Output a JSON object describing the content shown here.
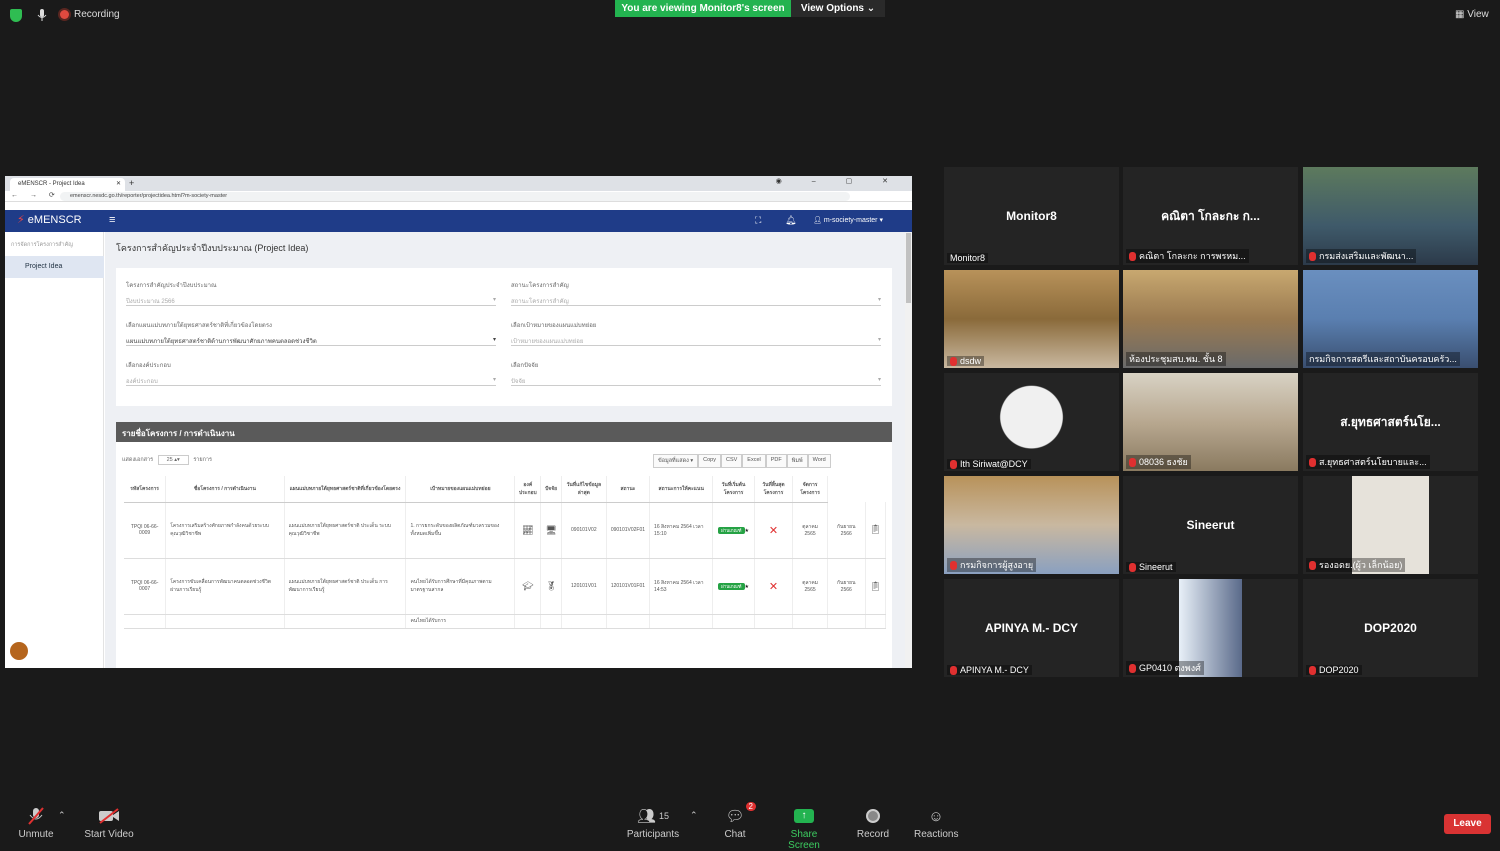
{
  "topbar": {
    "recording": "Recording",
    "viewing_banner": "You are viewing Monitor8's screen",
    "view_options": "View Options",
    "view": "View"
  },
  "browser": {
    "tab_title": "eMENSCR - Project Idea",
    "url": "emenscr.nesdc.go.th/reporter/projectidea.html?m-society-master"
  },
  "app": {
    "logo": "eMENSCR",
    "user": "m-society-master",
    "sidebar_section": "การจัดการโครงการสำคัญ",
    "sidebar_item": "Project Idea",
    "page_title": "โครงการสำคัญประจำปีงบประมาณ (Project Idea)",
    "filters": {
      "f1_label": "โครงการสำคัญประจำปีงบประมาณ",
      "f1_value": "ปีงบประมาณ 2566",
      "f2_label": "สถานะโครงการสำคัญ",
      "f2_value": "สถานะโครงการสำคัญ",
      "f3_label": "เลือกแผนแม่บทภายใต้ยุทธศาสตร์ชาติที่เกี่ยวข้องโดยตรง",
      "f3_value": "แผนแม่บทภายใต้ยุทธศาสตร์ชาติด้านการพัฒนาศักยภาพคนตลอดช่วงชีวิต",
      "f4_label": "เลือกเป้าหมายของแผนแม่บทย่อย",
      "f4_value": "เป้าหมายของแผนแม่บทย่อย",
      "f5_label": "เลือกองค์ประกอบ",
      "f5_value": "องค์ประกอบ",
      "f6_label": "เลือกปัจจัย",
      "f6_value": "ปัจจัย"
    },
    "list_header": "รายชื่อโครงการ / การดำเนินงาน",
    "show_label": "แสดงเอกสาร",
    "show_count": "25",
    "show_unit": "รายการ",
    "export_buttons": [
      "ข้อมูลที่แสดง ▾",
      "Copy",
      "CSV",
      "Excel",
      "PDF",
      "พิมพ์",
      "Word"
    ],
    "columns": [
      "รหัสโครงการ",
      "ชื่อโครงการ / การดำเนินงาน",
      "แผนแม่บทภายใต้ยุทธศาสตร์ชาติที่เกี่ยวข้องโดยตรง",
      "เป้าหมายของแผนแม่บทย่อย",
      "องค์ประกอบ",
      "ปัจจัย",
      "วันที่แก้ไขข้อมูลล่าสุด",
      "สถานะ",
      "สถานะการให้คะแนน",
      "วันที่เริ่มต้นโครงการ",
      "วันที่สิ้นสุดโครงการ",
      "จัดการโครงการ"
    ],
    "rows": [
      {
        "id": "TPQI 06-66-0009",
        "name": "โครงการเสริมสร้างศักยภาพกำลังคนด้วยระบบคุณวุฒิวิชาชีพ",
        "plan": "แผนแม่บทภายใต้ยุทธศาสตร์ชาติ ประเด็น ระบบคุณวุฒิวิชาชีพ",
        "goal": "1. การยกระดับของผลิตภัณฑ์มวลรวมของทั้งหมดเพิ่มขึ้น",
        "factor": "090101V02",
        "updated": "090101V02F01",
        "status": "16 สิงหาคม 2564 เวลา 15:10",
        "score": "ผ่านเกณฑ์",
        "start": "ตุลาคม 2565",
        "end": "กันยายน 2566"
      },
      {
        "id": "TPQI 06-66-0007",
        "name": "โครงการขับเคลื่อนการพัฒนาคนตลอดช่วงชีวิตผ่านการเรียนรู้",
        "plan": "แผนแม่บทภายใต้ยุทธศาสตร์ชาติ ประเด็น การพัฒนาการเรียนรู้",
        "goal": "คนไทยได้รับการศึกษาที่มีคุณภาพตามมาตรฐานสากล",
        "factor": "120101V01",
        "updated": "120101V01F01",
        "status": "16 สิงหาคม 2564 เวลา 14:53",
        "score": "ผ่านเกณฑ์",
        "start": "ตุลาคม 2565",
        "end": "กันยายน 2566"
      }
    ],
    "partial_row": "คนไทยได้รับการ"
  },
  "gallery": [
    {
      "label": "Monitor8",
      "big": "Monitor8",
      "muted": false,
      "photo": false
    },
    {
      "label": "คณิตา โกละกะ การพรหม...",
      "big": "คณิตา โกละกะ ก...",
      "muted": true,
      "photo": false
    },
    {
      "label": "กรมส่งเสริมและพัฒนา...",
      "big": "",
      "muted": true,
      "photo": true
    },
    {
      "label": "dsdw",
      "big": "",
      "muted": true,
      "photo": true
    },
    {
      "label": "ห้องประชุมสบ.พม. ชั้น 8",
      "big": "",
      "muted": false,
      "photo": true
    },
    {
      "label": "กรมกิจการสตรีและสถาบันครอบครัว...",
      "big": "",
      "muted": false,
      "photo": true
    },
    {
      "label": "Ith Siriwat@DCY",
      "big": "",
      "muted": true,
      "photo": true
    },
    {
      "label": "08036 ธงชัย",
      "big": "",
      "muted": true,
      "photo": true
    },
    {
      "label": "ส.ยุทธศาสตร์นโยบายและ...",
      "big": "ส.ยุทธศาสตร์นโย...",
      "muted": true,
      "photo": false
    },
    {
      "label": "กรมกิจการผู้สูงอายุ",
      "big": "",
      "muted": true,
      "photo": true
    },
    {
      "label": "Sineerut",
      "big": "Sineerut",
      "muted": true,
      "photo": false
    },
    {
      "label": "รองอดย.(ผู้ว เล็กน้อย)",
      "big": "",
      "muted": true,
      "photo": true
    },
    {
      "label": "APINYA M.- DCY",
      "big": "APINYA M.- DCY",
      "muted": true,
      "photo": false
    },
    {
      "label": "GP0410 ตงพงศ์",
      "big": "",
      "muted": true,
      "photo": true
    },
    {
      "label": "DOP2020",
      "big": "DOP2020",
      "muted": true,
      "photo": false
    }
  ],
  "toolbar": {
    "unmute": "Unmute",
    "start_video": "Start Video",
    "participants": "Participants",
    "participants_count": "15",
    "chat": "Chat",
    "chat_badge": "2",
    "share_screen": "Share Screen",
    "record": "Record",
    "reactions": "Reactions",
    "leave": "Leave"
  }
}
